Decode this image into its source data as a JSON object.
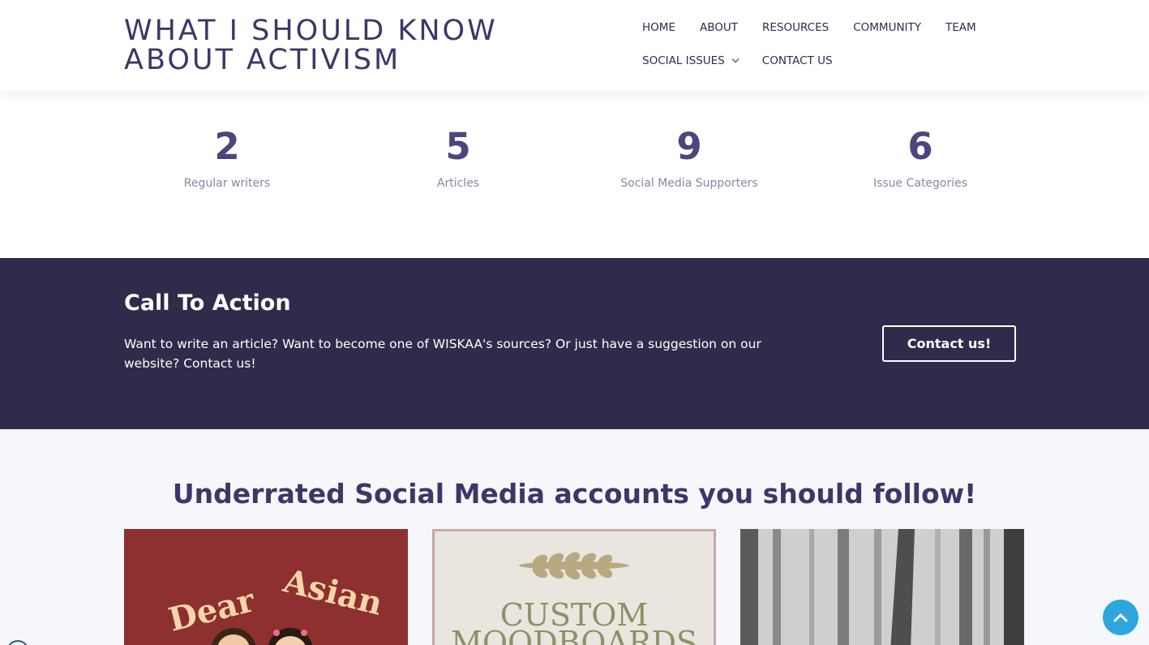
{
  "header": {
    "site_title": "WHAT I SHOULD KNOW ABOUT ACTIVISM",
    "nav": [
      {
        "label": "HOME"
      },
      {
        "label": "ABOUT"
      },
      {
        "label": "RESOURCES"
      },
      {
        "label": "COMMUNITY"
      },
      {
        "label": "TEAM"
      },
      {
        "label": "SOCIAL ISSUES",
        "has_dropdown": true
      },
      {
        "label": "CONTACT US"
      }
    ]
  },
  "stats": [
    {
      "value": "2",
      "label": "Regular writers"
    },
    {
      "value": "5",
      "label": "Articles"
    },
    {
      "value": "9",
      "label": "Social Media Supporters"
    },
    {
      "value": "6",
      "label": "Issue Categories"
    }
  ],
  "cta": {
    "title": "Call To Action",
    "text": "Want to write an article? Want to become one of WISKAA's sources? Or just have a suggestion on our website? Contact us!",
    "button_label": "Contact us!"
  },
  "social": {
    "heading": "Underrated Social Media accounts you should follow!",
    "cards": [
      {
        "image_text_1": "Dear",
        "image_text_2": "Asian"
      },
      {
        "image_text_1": "CUSTOM",
        "image_text_2": "MOODBOARDS"
      },
      {
        "image_description": "misty-forest-photo"
      }
    ]
  },
  "colors": {
    "primary_dark": "#2e2c4a",
    "heading_purple": "#3c3768",
    "accent_blue": "#2ea6dc"
  },
  "icons": {
    "scroll_top": "chevron-up-icon",
    "dropdown": "chevron-down-icon"
  }
}
